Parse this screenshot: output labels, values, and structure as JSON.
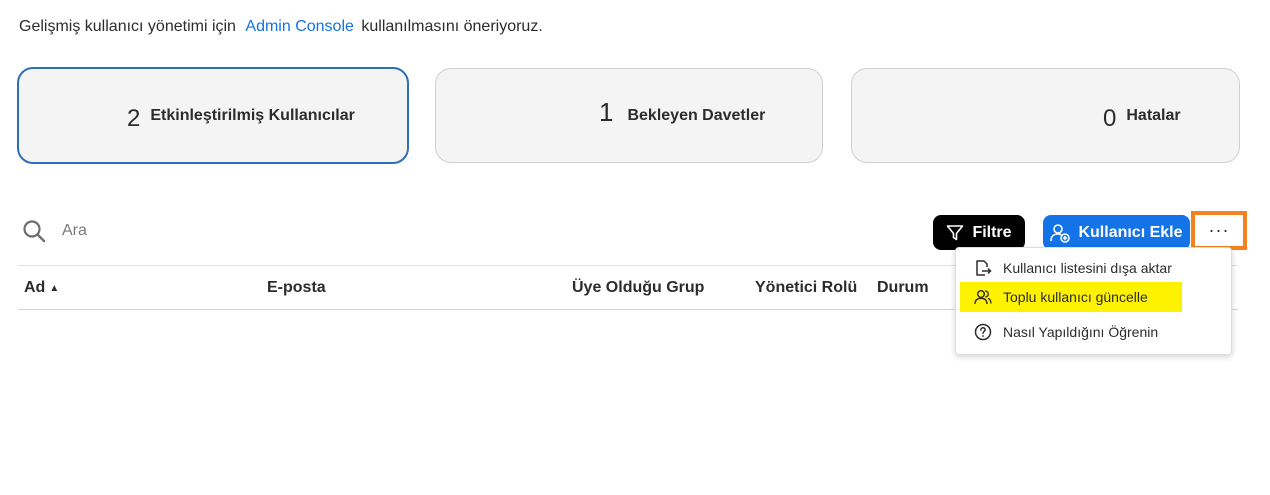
{
  "banner": {
    "prefix": "Gelişmiş kullanıcı yönetimi için",
    "link": "Admin Console",
    "suffix": "kullanılmasını öneriyoruz."
  },
  "cards": {
    "users": {
      "count": "2",
      "label": "Etkinleştirilmiş Kullanıcılar"
    },
    "invites": {
      "count": "1",
      "label": "Bekleyen Davetler"
    },
    "errors": {
      "count": "0",
      "label": "Hatalar"
    }
  },
  "search": {
    "placeholder": "Ara",
    "icon": "search-icon"
  },
  "toolbar": {
    "filter_label": "Filtre",
    "add_user_label": "Kullanıcı Ekle",
    "more_label": "···"
  },
  "table": {
    "columns": [
      "Ad",
      "E-posta",
      "Üye Olduğu Grup",
      "Yönetici Rolü",
      "Durum"
    ]
  },
  "menu": {
    "items": [
      {
        "label": "Kullanıcı listesini dışa aktar",
        "icon": "export-icon"
      },
      {
        "label": "Toplu kullanıcı güncelle",
        "icon": "users-icon"
      },
      {
        "label": "Nasıl Yapıldığını Öğrenin",
        "icon": "help-icon"
      }
    ]
  },
  "colors": {
    "accent": "#1473e6",
    "highlight": "#fff200",
    "annotation": "#f58220",
    "active_card_border": "#2d6fb8"
  }
}
